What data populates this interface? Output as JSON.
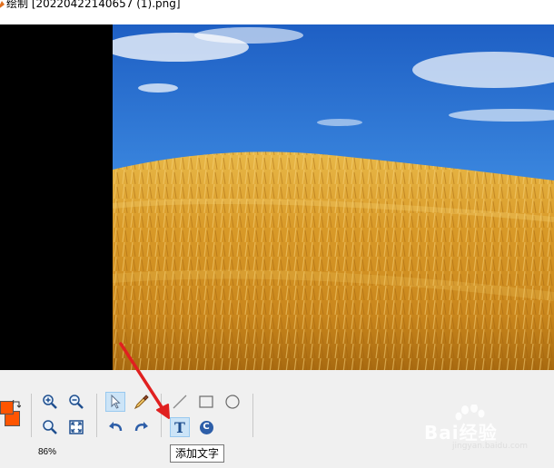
{
  "window": {
    "title": "绘制 [20220422140657 (1).png]"
  },
  "colors": {
    "foreground": "#ff5500",
    "background": "#ff5500",
    "accent": "#cce4f7",
    "annotation_arrow": "#e02020"
  },
  "toolbar": {
    "zoom_level": "86%",
    "tools": {
      "zoom_in": "zoom-in-icon",
      "zoom_out": "zoom-out-icon",
      "zoom_custom": "magnifier-icon",
      "fit": "fit-to-window-icon",
      "select": "pointer-icon",
      "eyedropper": "eyedropper-icon",
      "undo": "undo-icon",
      "redo": "redo-icon",
      "line": "line-icon",
      "rectangle": "rectangle-icon",
      "ellipse": "ellipse-icon",
      "text": "text-icon",
      "copyright": "copyright-icon"
    },
    "text_tool_glyph": "T",
    "copyright_glyph": "C",
    "tooltip": "添加文字"
  },
  "watermark": {
    "logo": "Bai经验",
    "url": "jingyan.baidu.com"
  }
}
